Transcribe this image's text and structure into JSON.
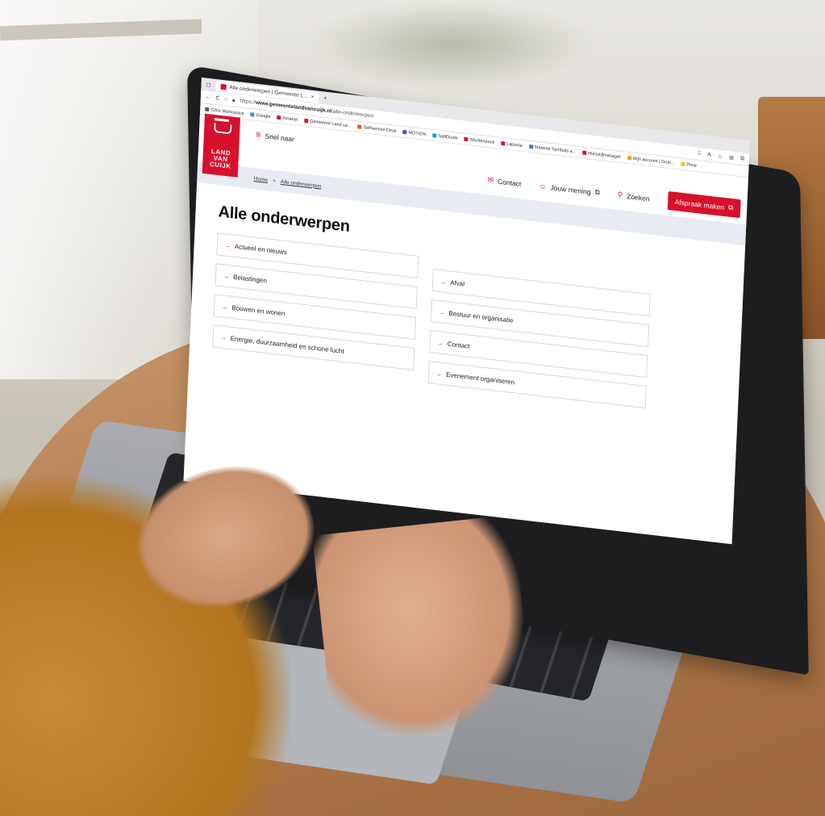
{
  "browser": {
    "tab_title": "Alle onderwerpen | Gemeente L...",
    "new_tab": "+",
    "url_prefix": "https://",
    "url_domain": "www.gemeentelandvancuijk.nl",
    "url_path": "/alle-onderwerpen",
    "bookmarks": [
      {
        "label": "Citrix Workspace",
        "color": "#5b5b5b"
      },
      {
        "label": "Google",
        "color": "#4285f4"
      },
      {
        "label": "Intranet",
        "color": "#d8102c"
      },
      {
        "label": "Gemeente Land va...",
        "color": "#d8102c"
      },
      {
        "label": "Selfservice Desk",
        "color": "#e2601a"
      },
      {
        "label": "MOTION",
        "color": "#6a3cc9"
      },
      {
        "label": "SelfGuide",
        "color": "#20a4a8"
      },
      {
        "label": "Shutterstock",
        "color": "#d8102c"
      },
      {
        "label": "Laposta",
        "color": "#d8102c"
      },
      {
        "label": "Material Symbols a...",
        "color": "#2f7bd8"
      },
      {
        "label": "Huisstijlmanager",
        "color": "#d8102c"
      },
      {
        "label": "Mijn account | Druk...",
        "color": "#f0a020"
      },
      {
        "label": "Prive",
        "color": "#f3c000"
      }
    ]
  },
  "site": {
    "logo": {
      "line1": "LAND",
      "line2": "VAN",
      "line3": "CUIJK"
    },
    "menu_label": "Snel naar",
    "nav": {
      "contact": "Contact",
      "opinion": "Jouw mening",
      "search": "Zoeken",
      "appointment": "Afspraak maken"
    },
    "breadcrumb": {
      "home": "Home",
      "separator": ">",
      "current": "Alle onderwerpen"
    },
    "page_title": "Alle onderwerpen",
    "topics_left": [
      "Actueel en nieuws",
      "Belastingen",
      "Bouwen en wonen",
      "Energie, duurzaamheid en schone lucht"
    ],
    "topics_right": [
      "Afval",
      "Bestuur en organisatie",
      "Contact",
      "Evenement organiseren"
    ],
    "accent_color": "#d8102c"
  }
}
